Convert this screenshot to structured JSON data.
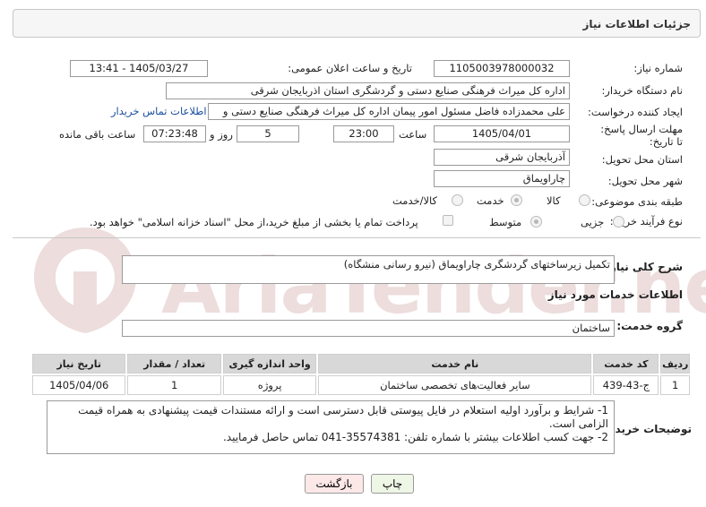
{
  "header": {
    "title": "جزئیات اطلاعات نیاز"
  },
  "fields": {
    "need_number_label": "شماره نیاز:",
    "need_number": "1105003978000032",
    "announce_label": "تاریخ و ساعت اعلان عمومی:",
    "announce_value": "1405/03/27 - 13:41",
    "buyer_label": "نام دستگاه خریدار:",
    "buyer_value": "اداره کل میراث فرهنگی  صنایع دستی و گردشگری استان اذربایجان شرقی",
    "requester_label": "ایجاد کننده درخواست:",
    "requester_value": "علی محمدزاده فاضل مسئول امور پیمان اداره کل میراث فرهنگی  صنایع دستی و",
    "buyer_contact_link": "اطلاعات تماس خریدار",
    "deadline_label": "مهلت ارسال پاسخ: تا تاریخ:",
    "deadline_date": "1405/04/01",
    "time_label": "ساعت",
    "deadline_time": "23:00",
    "days_value": "5",
    "days_label": "روز و",
    "remaining_time": "07:23:48",
    "remaining_label": "ساعت باقی مانده",
    "province_label": "استان محل تحویل:",
    "province_value": "آذربایجان شرقی",
    "city_label": "شهر محل تحویل:",
    "city_value": "چاراویماق",
    "category_label": "طبقه بندی موضوعی:",
    "category_options": [
      "کالا",
      "خدمت",
      "کالا/خدمت"
    ],
    "process_label": "نوع فرآیند خرید :",
    "process_options": [
      "جزیی",
      "متوسط"
    ],
    "payment_note": "پرداخت تمام یا بخشی از مبلغ خرید،از محل \"اسناد خزانه اسلامی\" خواهد بود."
  },
  "description": {
    "label": "شرح کلی نیاز:",
    "value": "تکمیل زیرساختهای گردشگری چاراویماق (نیرو رسانی منشگاه)"
  },
  "services": {
    "section_title": "اطلاعات خدمات مورد نیاز",
    "group_label": "گروه خدمت:",
    "group_value": "ساختمان",
    "columns": [
      "ردیف",
      "کد خدمت",
      "نام خدمت",
      "واحد اندازه گیری",
      "تعداد / مقدار",
      "تاریخ نیاز"
    ],
    "rows": [
      [
        "1",
        "ج-43-439",
        "سایر فعالیت‌های تخصصی ساختمان",
        "پروژه",
        "1",
        "1405/04/06"
      ]
    ]
  },
  "notes": {
    "label": "توضیحات خریدار:",
    "line1": "1- شرایط و برآورد اولیه استعلام در فایل پیوستی قابل دسترسی است و ارائه مستندات قیمت پیشنهادی به همراه قیمت الزامی است.",
    "line2": "2- جهت کسب اطلاعات بیشتر  با شماره تلفن: 35574381-041  تماس حاصل فرمایید."
  },
  "buttons": {
    "print": "چاپ",
    "back": "بازگشت"
  },
  "watermark": {
    "text": "AriaTender.net"
  },
  "colors": {
    "back_button": "#fde8e8",
    "print_button": "#eef6e6",
    "link": "#1a4e9e",
    "table_header": "#d8d8d8"
  }
}
